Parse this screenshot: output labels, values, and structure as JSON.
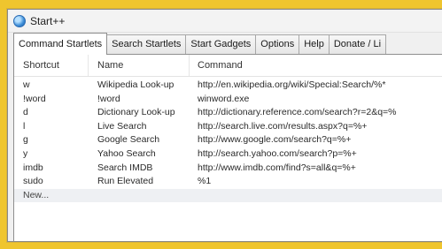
{
  "window": {
    "title": "Start++"
  },
  "tabs": [
    {
      "label": "Command Startlets",
      "active": true
    },
    {
      "label": "Search Startlets"
    },
    {
      "label": "Start Gadgets"
    },
    {
      "label": "Options"
    },
    {
      "label": "Help"
    },
    {
      "label": "Donate / Li"
    }
  ],
  "list": {
    "columns": [
      "Shortcut",
      "Name",
      "Command"
    ],
    "rows": [
      [
        "w",
        "Wikipedia Look-up",
        "http://en.wikipedia.org/wiki/Special:Search/%*"
      ],
      [
        "!word",
        "!word",
        "winword.exe"
      ],
      [
        "d",
        "Dictionary Look-up",
        "http://dictionary.reference.com/search?r=2&q=%"
      ],
      [
        "l",
        "Live Search",
        "http://search.live.com/results.aspx?q=%+"
      ],
      [
        "g",
        "Google Search",
        "http://www.google.com/search?q=%+"
      ],
      [
        "y",
        "Yahoo Search",
        "http://search.yahoo.com/search?p=%+"
      ],
      [
        "imdb",
        "Search IMDB",
        "http://www.imdb.com/find?s=all&q=%+"
      ],
      [
        "sudo",
        "Run Elevated",
        "%1"
      ]
    ],
    "new_label": "New..."
  },
  "colors": {
    "background": "#efc52e",
    "window": "#f0f0f0",
    "panel": "#ffffff",
    "new_row": "#eef0f3"
  }
}
